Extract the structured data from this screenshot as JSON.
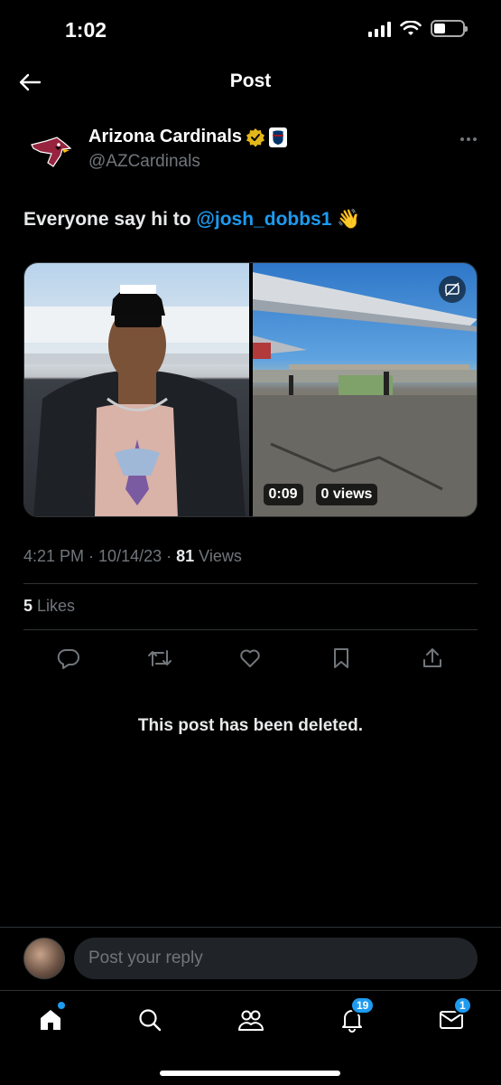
{
  "status_bar": {
    "time": "1:02"
  },
  "header": {
    "title": "Post"
  },
  "author": {
    "name": "Arizona Cardinals",
    "handle": "@AZCardinals"
  },
  "post": {
    "text": "Everyone say hi to ",
    "mention": "@josh_dobbs1",
    "emoji": " 👋"
  },
  "media": {
    "video_duration": "0:09",
    "video_views": "0 views"
  },
  "meta": {
    "time": "4:21 PM",
    "date": "10/14/23",
    "views_count": "81",
    "views_label": " Views",
    "sep": " · "
  },
  "likes": {
    "count": "5",
    "label": " Likes"
  },
  "deleted_message": "This post has been deleted.",
  "reply": {
    "placeholder": "Post your reply"
  },
  "nav": {
    "notifications_badge": "19",
    "messages_badge": "1"
  },
  "icons": [
    "back-arrow-icon",
    "verified-icon",
    "nfl-icon",
    "more-icon",
    "reply-icon",
    "repost-icon",
    "like-icon",
    "bookmark-icon",
    "share-icon",
    "home-icon",
    "search-icon",
    "communities-icon",
    "notifications-icon",
    "messages-icon"
  ],
  "colors": {
    "accent": "#1d9bf0",
    "background": "#000000",
    "muted": "#71767b",
    "cardinals_red": "#97233f",
    "verified_gold": "#e2b719"
  }
}
